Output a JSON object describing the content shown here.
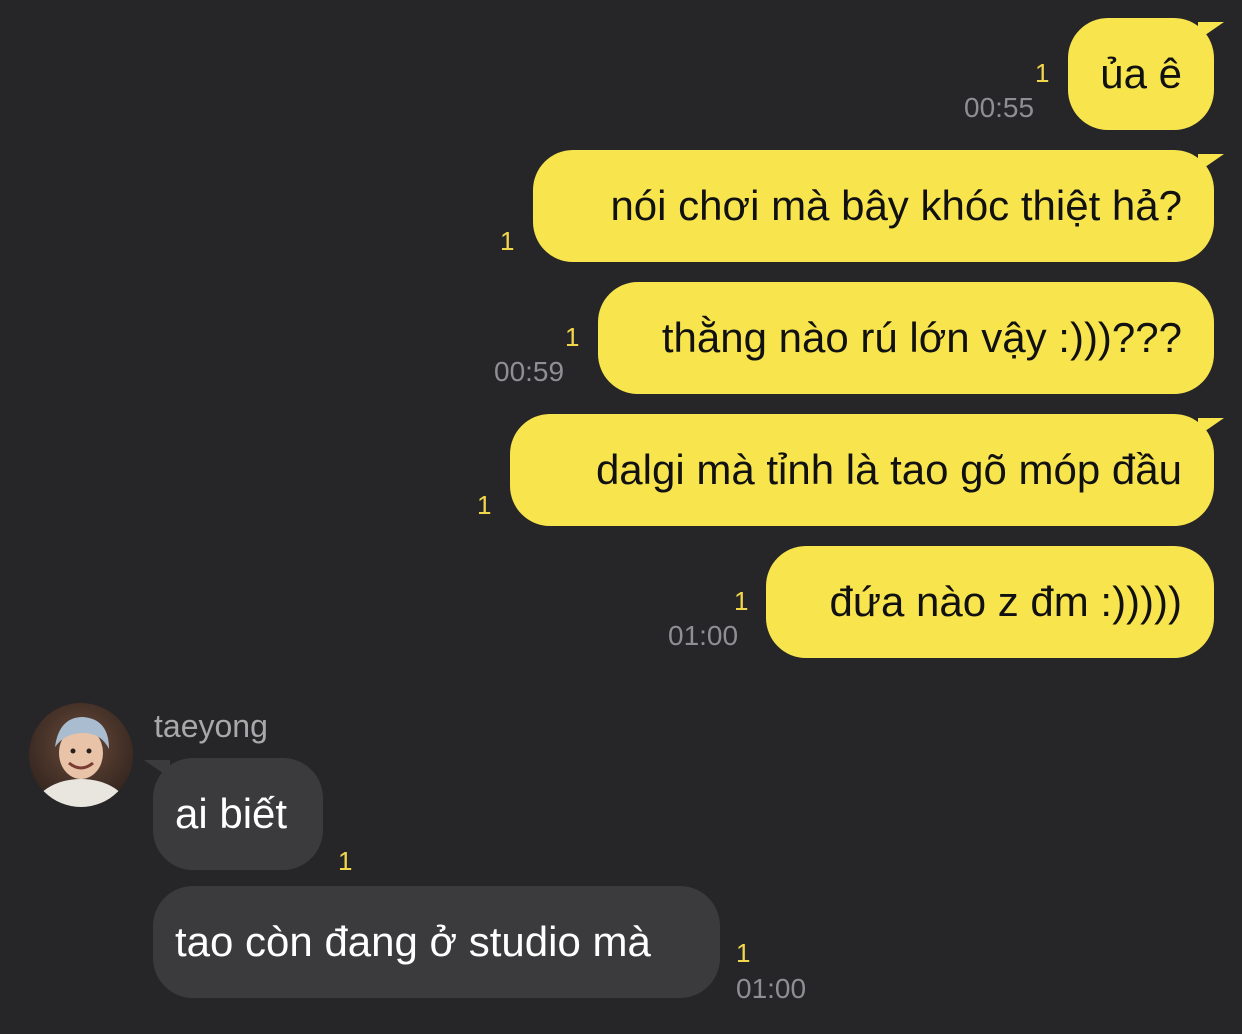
{
  "conversation": {
    "sender_name": "taeyong",
    "messages": [
      {
        "from": "me",
        "text": "ủa ê",
        "unread": "1",
        "time": "00:55"
      },
      {
        "from": "me",
        "text": "nói chơi mà bây khóc thiệt hả?",
        "unread": "1",
        "time": ""
      },
      {
        "from": "me",
        "text": "thằng nào rú lớn vậy :)))???",
        "unread": "1",
        "time": "00:59"
      },
      {
        "from": "me",
        "text": "dalgi mà tỉnh là tao gõ móp đầu",
        "unread": "1",
        "time": ""
      },
      {
        "from": "me",
        "text": "đứa nào z đm :)))))",
        "unread": "1",
        "time": "01:00"
      },
      {
        "from": "taeyong",
        "text": "ai biết",
        "unread": "1",
        "time": ""
      },
      {
        "from": "taeyong",
        "text": "tao còn đang ở studio mà",
        "unread": "1",
        "time": "01:00"
      }
    ]
  },
  "colors": {
    "background": "#262628",
    "my_bubble": "#f8e54e",
    "their_bubble": "#3b3b3d",
    "unread_count": "#f2d64b",
    "timestamp": "#8e8e93"
  },
  "icons": {
    "avatar": "profile-photo"
  }
}
